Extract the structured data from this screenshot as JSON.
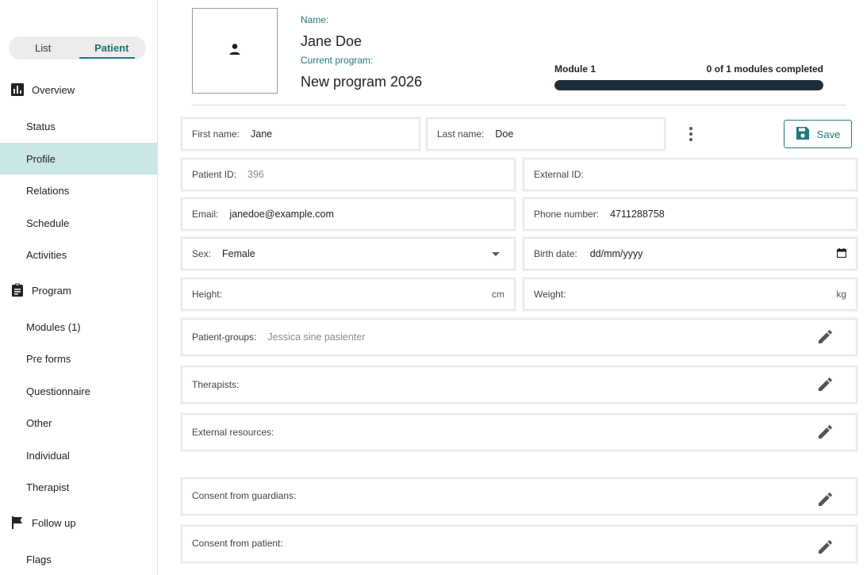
{
  "toggle": {
    "list": "List",
    "patient": "Patient"
  },
  "sidebar": {
    "overview": "Overview",
    "program": "Program",
    "follow_up": "Follow up",
    "items": {
      "status": "Status",
      "profile": "Profile",
      "relations": "Relations",
      "schedule": "Schedule",
      "activities": "Activities",
      "modules": "Modules (1)",
      "pre_forms": "Pre forms",
      "questionnaire": "Questionnaire",
      "other": "Other",
      "individual": "Individual",
      "therapist": "Therapist",
      "flags": "Flags"
    }
  },
  "header": {
    "name_label": "Name:",
    "name": "Jane Doe",
    "program_label": "Current program:",
    "program": "New program 2026",
    "module_label": "Module 1",
    "modules_completed": "0 of 1 modules completed",
    "progress_fraction": 0.0
  },
  "form": {
    "first_name": {
      "label": "First name:",
      "value": "Jane"
    },
    "last_name": {
      "label": "Last name:",
      "value": "Doe"
    },
    "save": "Save",
    "patient_id": {
      "label": "Patient ID:",
      "value": "396"
    },
    "external_id": {
      "label": "External ID:",
      "value": ""
    },
    "email": {
      "label": "Email:",
      "value": "janedoe@example.com"
    },
    "phone": {
      "label": "Phone number:",
      "value": "4711288758"
    },
    "sex": {
      "label": "Sex:",
      "value": "Female"
    },
    "birth_date": {
      "label": "Birth date:",
      "value": "dd/mm/yyyy"
    },
    "height": {
      "label": "Height:",
      "unit": "cm"
    },
    "weight": {
      "label": "Weight:",
      "unit": "kg"
    },
    "patient_groups": {
      "label": "Patient-groups:",
      "value": "Jessica sine pasienter"
    },
    "therapists": {
      "label": "Therapists:"
    },
    "external_resources": {
      "label": "External resources:"
    },
    "consent_guardians": {
      "label": "Consent from guardians:"
    },
    "consent_patient": {
      "label": "Consent from patient:"
    }
  },
  "colors": {
    "accent": "#1f7a7a",
    "active_nav": "#c9e7e6",
    "progress_bar": "#1f2d3a"
  },
  "icons": [
    "chart-icon",
    "clipboard-icon",
    "flag-icon",
    "person-icon",
    "more-vert-icon",
    "save-icon",
    "dropdown-arrow-icon",
    "calendar-icon",
    "pencil-icon"
  ]
}
